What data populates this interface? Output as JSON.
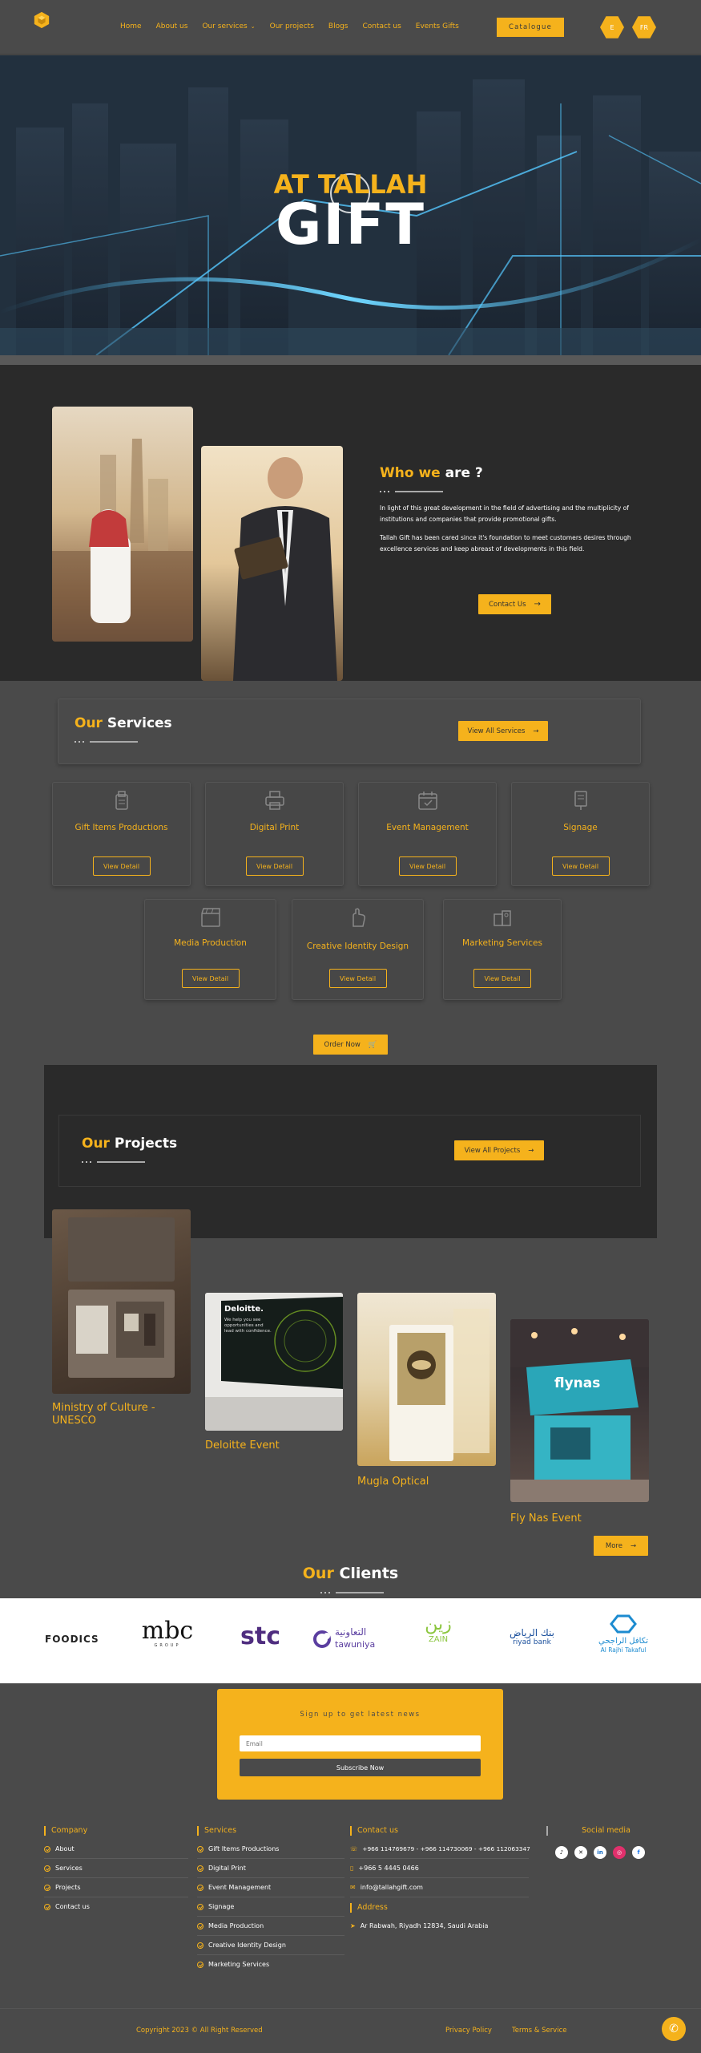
{
  "header": {
    "nav": [
      "Home",
      "About us",
      "Our services",
      "Our projects",
      "Blogs",
      "Contact us",
      "Events Gifts"
    ],
    "catalogue_label": "Catalogue",
    "lang_1": "E",
    "lang_2": "FR"
  },
  "hero": {
    "line1": "AT TALLAH",
    "line2": "GIFT"
  },
  "about": {
    "title_accent": "Who we",
    "title_rest": "are ?",
    "paragraph1": "In light of this great development in the field of advertising and the multiplicity of institutions and companies that provide promotional gifts.",
    "paragraph2": "Tallah Gift has been cared since it's foundation to meet customers desires through excellence services and keep abreast of developments in this field.",
    "button_label": "Contact Us"
  },
  "services": {
    "title_accent": "Our",
    "title_rest": "Services",
    "view_all_label": "View All Services",
    "items": [
      {
        "title": "Gift Items Productions",
        "button": "View Detail",
        "icon": "gift-box-icon"
      },
      {
        "title": "Digital Print",
        "button": "View Detail",
        "icon": "printer-icon"
      },
      {
        "title": "Event Management",
        "button": "View Detail",
        "icon": "calendar-icon"
      },
      {
        "title": "Signage",
        "button": "View Detail",
        "icon": "signage-icon"
      },
      {
        "title": "Media Production",
        "button": "View Detail",
        "icon": "clapperboard-icon"
      },
      {
        "title": "Creative Identity Design",
        "button": "View Detail",
        "icon": "design-hand-icon"
      },
      {
        "title": "Marketing Services",
        "button": "View Detail",
        "icon": "marketing-icon"
      }
    ],
    "order_now_label": "Order Now"
  },
  "projects": {
    "title_accent": "Our",
    "title_rest": "Projects",
    "view_all_label": "View All Projects",
    "items": [
      {
        "title": "Ministry of Culture - UNESCO"
      },
      {
        "title": "Deloitte Event",
        "image_text": "Deloitte.",
        "image_subtext": "We help you see opportunities and lead with confidence."
      },
      {
        "title": "Mugla Optical"
      },
      {
        "title": "Fly Nas Event",
        "image_text": "flynas"
      }
    ],
    "more_label": "More"
  },
  "clients": {
    "title_accent": "Our",
    "title_rest": "Clients",
    "logos": [
      {
        "name": "FOODICS"
      },
      {
        "name": "mbc",
        "sub": "GROUP"
      },
      {
        "name": "stc"
      },
      {
        "name": "tawuniya",
        "arabic": "التعاونية"
      },
      {
        "name": "ZAIN",
        "arabic": "زين"
      },
      {
        "name": "riyad bank",
        "arabic": "بنك الرياض"
      },
      {
        "name": "Al Rajhi Takaful",
        "arabic": "تكافل الراجحي"
      }
    ]
  },
  "newsletter": {
    "heading": "Sign up to get latest news",
    "email_placeholder": "Email",
    "subscribe_label": "Subscribe Now"
  },
  "footer": {
    "company_title": "Company",
    "company_links": [
      "About",
      "Services",
      "Projects",
      "Contact us"
    ],
    "services_title": "Services",
    "services_links": [
      "Gift Items Productions",
      "Digital Print",
      "Event Management",
      "Signage",
      "Media Production",
      "Creative Identity Design",
      "Marketing Services"
    ],
    "contact_title": "Contact us",
    "phones": "+966 114769679 - +966 114730069 - +966 112063347",
    "mobile": "+966 5 4445 0466",
    "email": "info@tallahgift.com",
    "address_title": "Address",
    "address": "Ar Rabwah, Riyadh 12834, Saudi Arabia",
    "social_title": "Social media",
    "copyright": "Copyright 2023 © All Right Reserved",
    "privacy": "Privacy Policy",
    "terms": "Terms & Service"
  },
  "colors": {
    "accent": "#f5b21c",
    "dark": "#2a2a2a",
    "base": "#4a4a4a"
  }
}
